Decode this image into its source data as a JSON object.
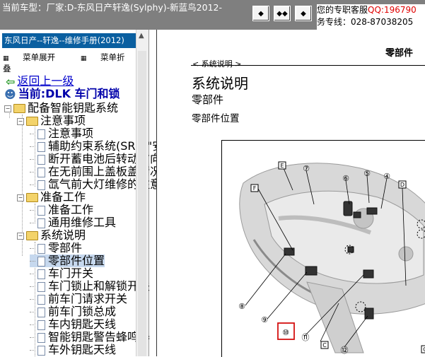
{
  "header": {
    "title": "当前车型：厂家:D-东风日产轩逸(Sylphy)-新蓝鸟2012-",
    "nav_buttons": [
      "prev-icon",
      "expand-icon",
      "next-icon"
    ],
    "service_line1_prefix": "您的专职客服",
    "service_line1_qq": "QQ:196790",
    "service_line2": "务专线：028-87038205"
  },
  "sidebar": {
    "manual_title": "东风日产--轩逸--维修手册(2012)",
    "expand_label": "菜单展开",
    "collapse_label": "菜单折叠",
    "back_label": "返回上一级",
    "current_label": "当前:DLK 车门和锁",
    "tree": [
      {
        "label": "配备智能钥匙系统",
        "level": 0,
        "type": "folder"
      },
      {
        "label": "注意事项",
        "level": 1,
        "type": "folder"
      },
      {
        "label": "注意事项",
        "level": 2,
        "type": "doc"
      },
      {
        "label": "辅助约束系统(SRS)\"安",
        "level": 2,
        "type": "doc"
      },
      {
        "label": "断开蓄电池后转动方向盘",
        "level": 2,
        "type": "doc"
      },
      {
        "label": "在无前围上盖板盖情况下",
        "level": 2,
        "type": "doc"
      },
      {
        "label": "氙气前大灯维修的注意事",
        "level": 2,
        "type": "doc"
      },
      {
        "label": "准备工作",
        "level": 1,
        "type": "folder"
      },
      {
        "label": "准备工作",
        "level": 2,
        "type": "doc"
      },
      {
        "label": "通用维修工具",
        "level": 2,
        "type": "doc"
      },
      {
        "label": "系统说明",
        "level": 1,
        "type": "folder"
      },
      {
        "label": "零部件",
        "level": 2,
        "type": "doc"
      },
      {
        "label": "零部件位置",
        "level": 2,
        "type": "doc",
        "selected": true
      },
      {
        "label": "车门开关",
        "level": 2,
        "type": "doc"
      },
      {
        "label": "车门锁止和解锁开关",
        "level": 2,
        "type": "doc"
      },
      {
        "label": "前车门请求开关",
        "level": 2,
        "type": "doc"
      },
      {
        "label": "前车门锁总成",
        "level": 2,
        "type": "doc"
      },
      {
        "label": "车内钥匙天线",
        "level": 2,
        "type": "doc"
      },
      {
        "label": "智能钥匙警告蜂鸣器",
        "level": 2,
        "type": "doc"
      },
      {
        "label": "车外钥匙天线",
        "level": 2,
        "type": "doc"
      }
    ]
  },
  "content": {
    "page_header": "零部件",
    "breadcrumb": "< 系统说明 >",
    "h1": "系统说明",
    "h2": "零部件",
    "h3": "零部件位置",
    "diagram_labels": {
      "letters": [
        "E",
        "F",
        "D",
        "C",
        "C"
      ],
      "numbers": [
        "⑦",
        "⑥",
        "⑤",
        "④",
        "⑧",
        "⑨",
        "⑩",
        "⑪",
        "⑫"
      ]
    },
    "highlight_color": "#d41010"
  }
}
